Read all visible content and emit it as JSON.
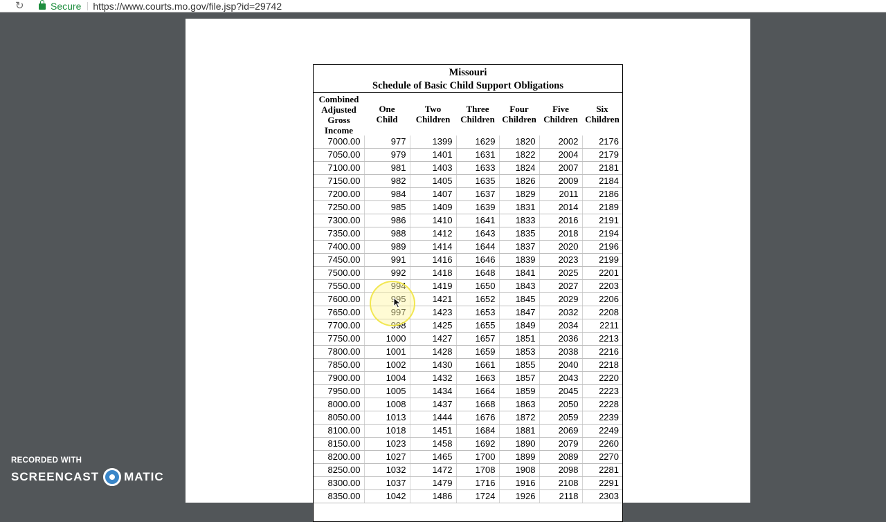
{
  "browser": {
    "secure_label": "Secure",
    "url": "https://www.courts.mo.gov/file.jsp?id=29742"
  },
  "document": {
    "title_line1": "Missouri",
    "title_line2": "Schedule of Basic Child Support Obligations",
    "columns": [
      [
        "Combined",
        "Adjusted",
        "Gross Income"
      ],
      [
        "One",
        "Child"
      ],
      [
        "Two",
        "Children"
      ],
      [
        "Three",
        "Children"
      ],
      [
        "Four",
        "Children"
      ],
      [
        "Five",
        "Children"
      ],
      [
        "Six",
        "Children"
      ]
    ],
    "rows": [
      [
        "7000.00",
        "977",
        "1399",
        "1629",
        "1820",
        "2002",
        "2176"
      ],
      [
        "7050.00",
        "979",
        "1401",
        "1631",
        "1822",
        "2004",
        "2179"
      ],
      [
        "7100.00",
        "981",
        "1403",
        "1633",
        "1824",
        "2007",
        "2181"
      ],
      [
        "7150.00",
        "982",
        "1405",
        "1635",
        "1826",
        "2009",
        "2184"
      ],
      [
        "7200.00",
        "984",
        "1407",
        "1637",
        "1829",
        "2011",
        "2186"
      ],
      [
        "7250.00",
        "985",
        "1409",
        "1639",
        "1831",
        "2014",
        "2189"
      ],
      [
        "7300.00",
        "986",
        "1410",
        "1641",
        "1833",
        "2016",
        "2191"
      ],
      [
        "7350.00",
        "988",
        "1412",
        "1643",
        "1835",
        "2018",
        "2194"
      ],
      [
        "7400.00",
        "989",
        "1414",
        "1644",
        "1837",
        "2020",
        "2196"
      ],
      [
        "7450.00",
        "991",
        "1416",
        "1646",
        "1839",
        "2023",
        "2199"
      ],
      [
        "7500.00",
        "992",
        "1418",
        "1648",
        "1841",
        "2025",
        "2201"
      ],
      [
        "7550.00",
        "994",
        "1419",
        "1650",
        "1843",
        "2027",
        "2203"
      ],
      [
        "7600.00",
        "995",
        "1421",
        "1652",
        "1845",
        "2029",
        "2206"
      ],
      [
        "7650.00",
        "997",
        "1423",
        "1653",
        "1847",
        "2032",
        "2208"
      ],
      [
        "7700.00",
        "998",
        "1425",
        "1655",
        "1849",
        "2034",
        "2211"
      ],
      [
        "7750.00",
        "1000",
        "1427",
        "1657",
        "1851",
        "2036",
        "2213"
      ],
      [
        "7800.00",
        "1001",
        "1428",
        "1659",
        "1853",
        "2038",
        "2216"
      ],
      [
        "7850.00",
        "1002",
        "1430",
        "1661",
        "1855",
        "2040",
        "2218"
      ],
      [
        "7900.00",
        "1004",
        "1432",
        "1663",
        "1857",
        "2043",
        "2220"
      ],
      [
        "7950.00",
        "1005",
        "1434",
        "1664",
        "1859",
        "2045",
        "2223"
      ],
      [
        "8000.00",
        "1008",
        "1437",
        "1668",
        "1863",
        "2050",
        "2228"
      ],
      [
        "8050.00",
        "1013",
        "1444",
        "1676",
        "1872",
        "2059",
        "2239"
      ],
      [
        "8100.00",
        "1018",
        "1451",
        "1684",
        "1881",
        "2069",
        "2249"
      ],
      [
        "8150.00",
        "1023",
        "1458",
        "1692",
        "1890",
        "2079",
        "2260"
      ],
      [
        "8200.00",
        "1027",
        "1465",
        "1700",
        "1899",
        "2089",
        "2270"
      ],
      [
        "8250.00",
        "1032",
        "1472",
        "1708",
        "1908",
        "2098",
        "2281"
      ],
      [
        "8300.00",
        "1037",
        "1479",
        "1716",
        "1916",
        "2108",
        "2291"
      ],
      [
        "8350.00",
        "1042",
        "1486",
        "1724",
        "1926",
        "2118",
        "2303"
      ]
    ]
  },
  "watermark": {
    "recorded_with": "RECORDED WITH",
    "brand_left": "SCREENCAST",
    "brand_right": "MATIC"
  },
  "colors": {
    "secure_green": "#1e8e3e",
    "viewer_background": "#525659",
    "highlight_yellow": "#f0e43c"
  }
}
